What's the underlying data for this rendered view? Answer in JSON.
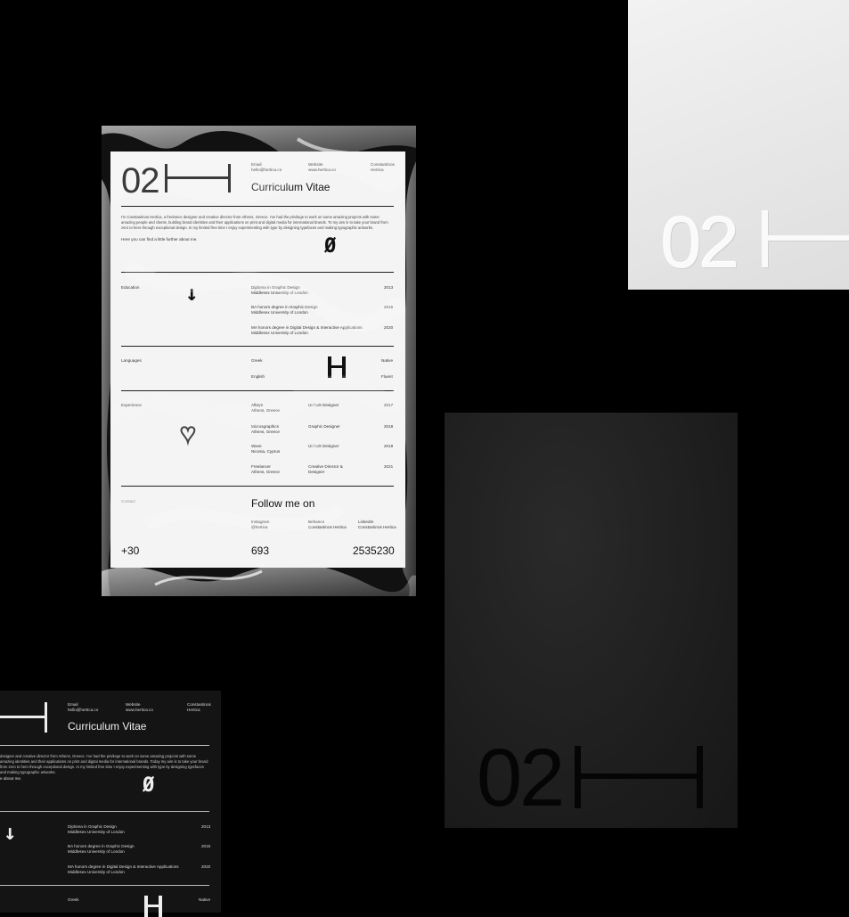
{
  "brand": {
    "mark": "02"
  },
  "cv_front": {
    "title": "Curriculum Vitae",
    "header_cols": [
      {
        "label": "Email",
        "value": "hello@hertica.co"
      },
      {
        "label": "Website",
        "value": "www.hertica.co"
      },
      {
        "label": "Constantinos",
        "value": "Hertica"
      }
    ],
    "intro": "I'm Constantinos Hertica, a freelance designer and creative director from Athens, Greece. I've had the privilege to work on some amazing projects with some amazing people and clients, building brand identities and their applications on print and digital media for international brands. To my aim is to take your brand from zero to hero through exceptional design. In my limited free time I enjoy experimenting with type by designing typefaces and making typographic artworks.",
    "intro2": "Here you can find a little further about me.",
    "sections": {
      "education": {
        "label": "Education",
        "items": [
          {
            "line1": "Diploma in Graphic Design",
            "line2": "Middlesex University of London",
            "year": "2013"
          },
          {
            "line1": "BA honors degree in Graphic Design",
            "line2": "Middlesex University of London",
            "year": "2015"
          },
          {
            "line1": "MA honors degree in Digital Design & Interactive Applications",
            "line2": "Middlesex University of London",
            "year": "2020"
          }
        ]
      },
      "languages": {
        "label": "Languages",
        "items": [
          {
            "name": "Greek",
            "level": "Native"
          },
          {
            "name": "English",
            "level": "Fluent"
          }
        ]
      },
      "experience": {
        "label": "Experience",
        "items": [
          {
            "place": "Allwyn",
            "city": "Athens, Greece",
            "role": "UI / UX Designer",
            "year": "2017"
          },
          {
            "place": "Microsgraphics",
            "city": "Athens, Greece",
            "role": "Graphic Designer",
            "year": "2018"
          },
          {
            "place": "Wave",
            "city": "Nicosia, Cyprus",
            "role": "UI / UX Designer",
            "year": "2019"
          },
          {
            "place": "Freelancer",
            "city": "Athens, Greece",
            "role": "Creative Director & Designer",
            "year": "2021"
          }
        ]
      },
      "social": {
        "label": "Contact",
        "heading": "Follow me on",
        "items": [
          {
            "name": "Instagram",
            "handle": "@hertica"
          },
          {
            "name": "Behance",
            "handle": "Constantinos Hertica"
          },
          {
            "name": "LinkedIn",
            "handle": "Constantinos Hertica"
          }
        ]
      }
    },
    "phone": [
      "+30",
      "693",
      "2535230"
    ]
  },
  "cv_back": {
    "title": "Curriculum Vitae",
    "header_cols": [
      {
        "label": "Email",
        "value": "hello@hertica.co"
      },
      {
        "label": "Website",
        "value": "www.hertica.co"
      },
      {
        "label": "Constantinos",
        "value": "Hertica"
      }
    ],
    "intro": "designer and creative director from Athens, Greece. I've had the privilege to work on some amazing projects with some amazing identities and their applications on print and digital media for international brands. Today my aim is to take your brand from zero to hero through exceptional design. In my limited free time I enjoy experimenting with type by designing typefaces and making typographic artworks.",
    "intro2": "e about me.",
    "education": [
      {
        "line1": "Diploma in Graphic Design",
        "line2": "Middlesex University of London",
        "year": "2013"
      },
      {
        "line1": "BA honors degree in Graphic Design",
        "line2": "Middlesex University of London",
        "year": "2015"
      },
      {
        "line1": "MA honors degree in Digital Design & Interactive Applications",
        "line2": "Middlesex University of London",
        "year": "2020"
      }
    ],
    "language": {
      "name": "Greek",
      "level": "Native"
    }
  }
}
